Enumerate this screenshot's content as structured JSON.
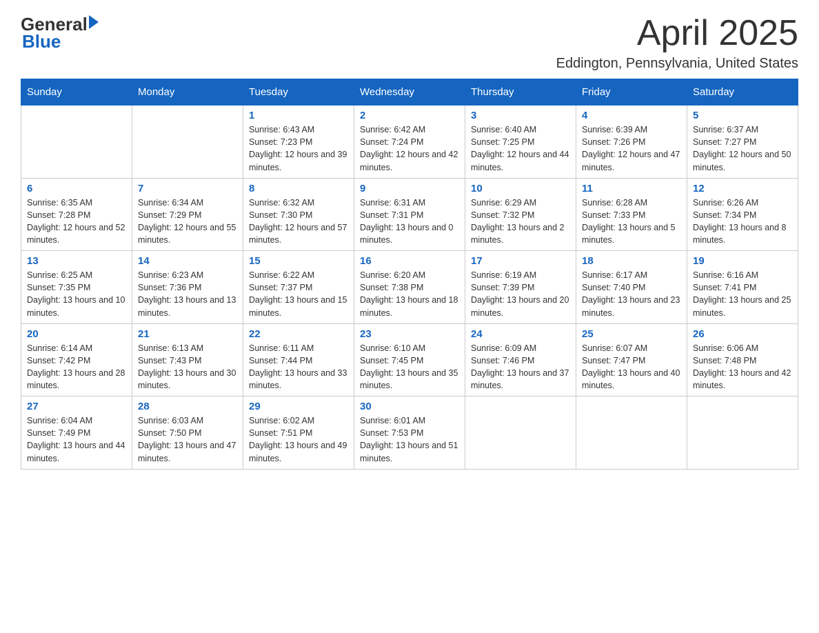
{
  "header": {
    "logo": {
      "general": "General",
      "blue": "Blue"
    },
    "title": "April 2025",
    "location": "Eddington, Pennsylvania, United States"
  },
  "calendar": {
    "days_of_week": [
      "Sunday",
      "Monday",
      "Tuesday",
      "Wednesday",
      "Thursday",
      "Friday",
      "Saturday"
    ],
    "weeks": [
      [
        {
          "day": "",
          "sunrise": "",
          "sunset": "",
          "daylight": ""
        },
        {
          "day": "",
          "sunrise": "",
          "sunset": "",
          "daylight": ""
        },
        {
          "day": "1",
          "sunrise": "Sunrise: 6:43 AM",
          "sunset": "Sunset: 7:23 PM",
          "daylight": "Daylight: 12 hours and 39 minutes."
        },
        {
          "day": "2",
          "sunrise": "Sunrise: 6:42 AM",
          "sunset": "Sunset: 7:24 PM",
          "daylight": "Daylight: 12 hours and 42 minutes."
        },
        {
          "day": "3",
          "sunrise": "Sunrise: 6:40 AM",
          "sunset": "Sunset: 7:25 PM",
          "daylight": "Daylight: 12 hours and 44 minutes."
        },
        {
          "day": "4",
          "sunrise": "Sunrise: 6:39 AM",
          "sunset": "Sunset: 7:26 PM",
          "daylight": "Daylight: 12 hours and 47 minutes."
        },
        {
          "day": "5",
          "sunrise": "Sunrise: 6:37 AM",
          "sunset": "Sunset: 7:27 PM",
          "daylight": "Daylight: 12 hours and 50 minutes."
        }
      ],
      [
        {
          "day": "6",
          "sunrise": "Sunrise: 6:35 AM",
          "sunset": "Sunset: 7:28 PM",
          "daylight": "Daylight: 12 hours and 52 minutes."
        },
        {
          "day": "7",
          "sunrise": "Sunrise: 6:34 AM",
          "sunset": "Sunset: 7:29 PM",
          "daylight": "Daylight: 12 hours and 55 minutes."
        },
        {
          "day": "8",
          "sunrise": "Sunrise: 6:32 AM",
          "sunset": "Sunset: 7:30 PM",
          "daylight": "Daylight: 12 hours and 57 minutes."
        },
        {
          "day": "9",
          "sunrise": "Sunrise: 6:31 AM",
          "sunset": "Sunset: 7:31 PM",
          "daylight": "Daylight: 13 hours and 0 minutes."
        },
        {
          "day": "10",
          "sunrise": "Sunrise: 6:29 AM",
          "sunset": "Sunset: 7:32 PM",
          "daylight": "Daylight: 13 hours and 2 minutes."
        },
        {
          "day": "11",
          "sunrise": "Sunrise: 6:28 AM",
          "sunset": "Sunset: 7:33 PM",
          "daylight": "Daylight: 13 hours and 5 minutes."
        },
        {
          "day": "12",
          "sunrise": "Sunrise: 6:26 AM",
          "sunset": "Sunset: 7:34 PM",
          "daylight": "Daylight: 13 hours and 8 minutes."
        }
      ],
      [
        {
          "day": "13",
          "sunrise": "Sunrise: 6:25 AM",
          "sunset": "Sunset: 7:35 PM",
          "daylight": "Daylight: 13 hours and 10 minutes."
        },
        {
          "day": "14",
          "sunrise": "Sunrise: 6:23 AM",
          "sunset": "Sunset: 7:36 PM",
          "daylight": "Daylight: 13 hours and 13 minutes."
        },
        {
          "day": "15",
          "sunrise": "Sunrise: 6:22 AM",
          "sunset": "Sunset: 7:37 PM",
          "daylight": "Daylight: 13 hours and 15 minutes."
        },
        {
          "day": "16",
          "sunrise": "Sunrise: 6:20 AM",
          "sunset": "Sunset: 7:38 PM",
          "daylight": "Daylight: 13 hours and 18 minutes."
        },
        {
          "day": "17",
          "sunrise": "Sunrise: 6:19 AM",
          "sunset": "Sunset: 7:39 PM",
          "daylight": "Daylight: 13 hours and 20 minutes."
        },
        {
          "day": "18",
          "sunrise": "Sunrise: 6:17 AM",
          "sunset": "Sunset: 7:40 PM",
          "daylight": "Daylight: 13 hours and 23 minutes."
        },
        {
          "day": "19",
          "sunrise": "Sunrise: 6:16 AM",
          "sunset": "Sunset: 7:41 PM",
          "daylight": "Daylight: 13 hours and 25 minutes."
        }
      ],
      [
        {
          "day": "20",
          "sunrise": "Sunrise: 6:14 AM",
          "sunset": "Sunset: 7:42 PM",
          "daylight": "Daylight: 13 hours and 28 minutes."
        },
        {
          "day": "21",
          "sunrise": "Sunrise: 6:13 AM",
          "sunset": "Sunset: 7:43 PM",
          "daylight": "Daylight: 13 hours and 30 minutes."
        },
        {
          "day": "22",
          "sunrise": "Sunrise: 6:11 AM",
          "sunset": "Sunset: 7:44 PM",
          "daylight": "Daylight: 13 hours and 33 minutes."
        },
        {
          "day": "23",
          "sunrise": "Sunrise: 6:10 AM",
          "sunset": "Sunset: 7:45 PM",
          "daylight": "Daylight: 13 hours and 35 minutes."
        },
        {
          "day": "24",
          "sunrise": "Sunrise: 6:09 AM",
          "sunset": "Sunset: 7:46 PM",
          "daylight": "Daylight: 13 hours and 37 minutes."
        },
        {
          "day": "25",
          "sunrise": "Sunrise: 6:07 AM",
          "sunset": "Sunset: 7:47 PM",
          "daylight": "Daylight: 13 hours and 40 minutes."
        },
        {
          "day": "26",
          "sunrise": "Sunrise: 6:06 AM",
          "sunset": "Sunset: 7:48 PM",
          "daylight": "Daylight: 13 hours and 42 minutes."
        }
      ],
      [
        {
          "day": "27",
          "sunrise": "Sunrise: 6:04 AM",
          "sunset": "Sunset: 7:49 PM",
          "daylight": "Daylight: 13 hours and 44 minutes."
        },
        {
          "day": "28",
          "sunrise": "Sunrise: 6:03 AM",
          "sunset": "Sunset: 7:50 PM",
          "daylight": "Daylight: 13 hours and 47 minutes."
        },
        {
          "day": "29",
          "sunrise": "Sunrise: 6:02 AM",
          "sunset": "Sunset: 7:51 PM",
          "daylight": "Daylight: 13 hours and 49 minutes."
        },
        {
          "day": "30",
          "sunrise": "Sunrise: 6:01 AM",
          "sunset": "Sunset: 7:53 PM",
          "daylight": "Daylight: 13 hours and 51 minutes."
        },
        {
          "day": "",
          "sunrise": "",
          "sunset": "",
          "daylight": ""
        },
        {
          "day": "",
          "sunrise": "",
          "sunset": "",
          "daylight": ""
        },
        {
          "day": "",
          "sunrise": "",
          "sunset": "",
          "daylight": ""
        }
      ]
    ]
  }
}
